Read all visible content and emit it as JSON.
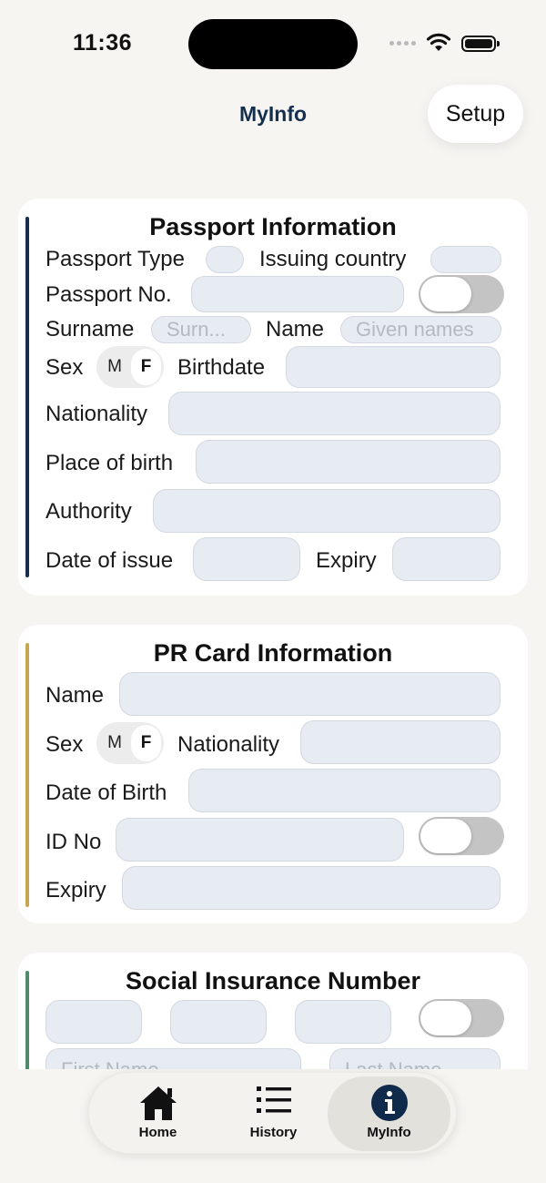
{
  "status": {
    "time": "11:36"
  },
  "nav": {
    "title": "MyInfo",
    "setup": "Setup"
  },
  "passport": {
    "title": "Passport Information",
    "passport_type": "Passport Type",
    "issuing_country": "Issuing country",
    "passport_no": "Passport No.",
    "surname": "Surname",
    "surname_ph": "Surn...",
    "name": "Name",
    "name_ph": "Given names",
    "sex": "Sex",
    "male": "M",
    "female": "F",
    "birthdate": "Birthdate",
    "nationality": "Nationality",
    "place_of_birth": "Place of birth",
    "authority": "Authority",
    "date_of_issue": "Date of issue",
    "expiry": "Expiry",
    "accent_color": "#15304f"
  },
  "pr_card": {
    "title": "PR Card Information",
    "name": "Name",
    "sex": "Sex",
    "male": "M",
    "female": "F",
    "nationality": "Nationality",
    "date_of_birth": "Date of Birth",
    "id_no": "ID No",
    "expiry": "Expiry",
    "accent_color": "#c8a550"
  },
  "sin": {
    "title": "Social Insurance Number",
    "first_name_ph": "First Name",
    "last_name_ph": "Last Name",
    "accent_color": "#4f8a6a"
  },
  "tabs": [
    {
      "label": "Home",
      "icon": "house-icon"
    },
    {
      "label": "History",
      "icon": "list-icon"
    },
    {
      "label": "MyInfo",
      "icon": "info-circle-icon",
      "active": true
    }
  ]
}
